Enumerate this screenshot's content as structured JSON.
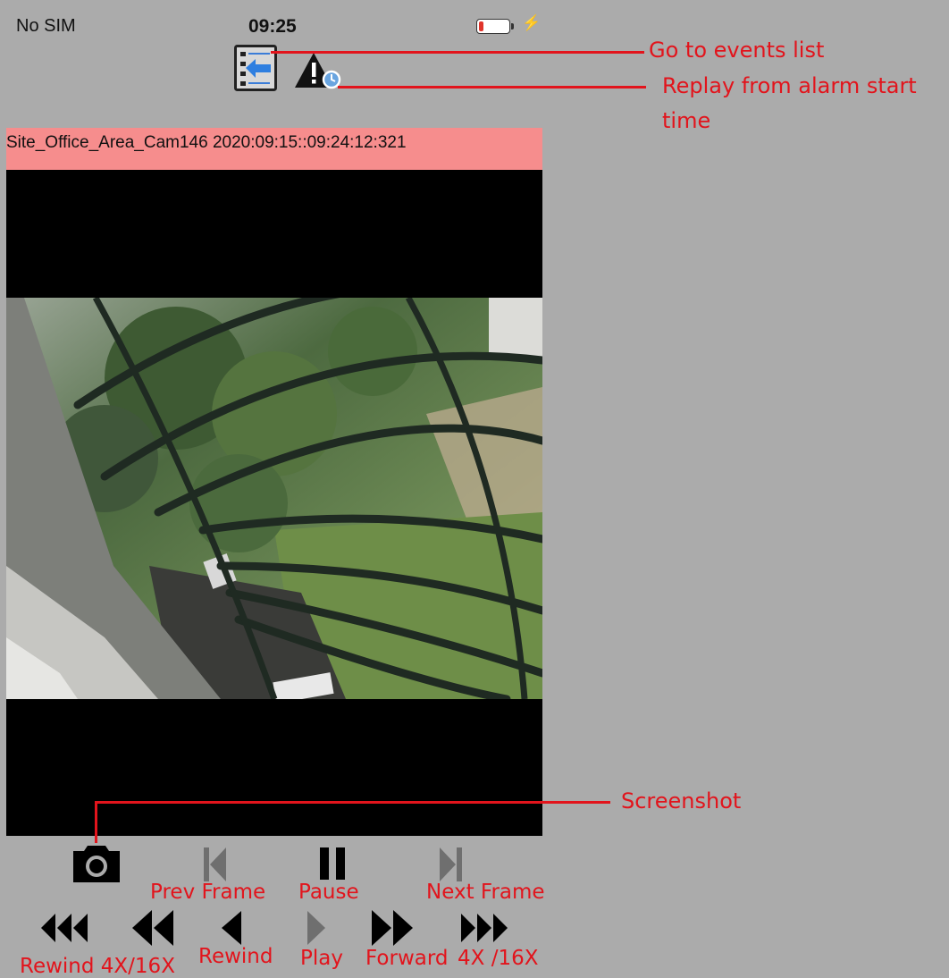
{
  "status_bar": {
    "carrier": "No SIM",
    "time": "09:25",
    "battery_level": 0.15,
    "battery_color": "#e0342b"
  },
  "toolbar": {
    "events_list_icon": "events-list-icon",
    "alarm_replay_icon": "alarm-clock-warning-icon"
  },
  "video": {
    "title": "Site_Office_Area_Cam146 2020:09:15::09:24:12:321",
    "title_bg": "#f68d8d"
  },
  "controls": {
    "screenshot_icon": "camera-icon",
    "prev_frame_icon": "skip-back-icon",
    "pause_icon": "pause-icon",
    "next_frame_icon": "skip-forward-icon",
    "rewind_fast_icon": "triple-rewind-icon",
    "rewind_double_icon": "double-rewind-icon",
    "rewind_icon": "rewind-icon",
    "play_icon": "play-icon",
    "forward_icon": "double-forward-icon",
    "forward_fast_icon": "triple-forward-icon"
  },
  "annotations": {
    "events_list": "Go to events list",
    "replay_alarm_line1": "Replay from alarm start",
    "replay_alarm_line2": "time",
    "screenshot": "Screenshot",
    "prev_frame": "Prev Frame",
    "pause": "Pause",
    "next_frame": "Next Frame",
    "rewind_fast": "Rewind 4X/16X",
    "rewind": "Rewind",
    "play": "Play",
    "forward": "Forward",
    "forward_fast": "4X /16X"
  },
  "colors": {
    "annotation": "#e2141c",
    "background": "#ababab",
    "disabled_control": "#6f6f6f"
  }
}
